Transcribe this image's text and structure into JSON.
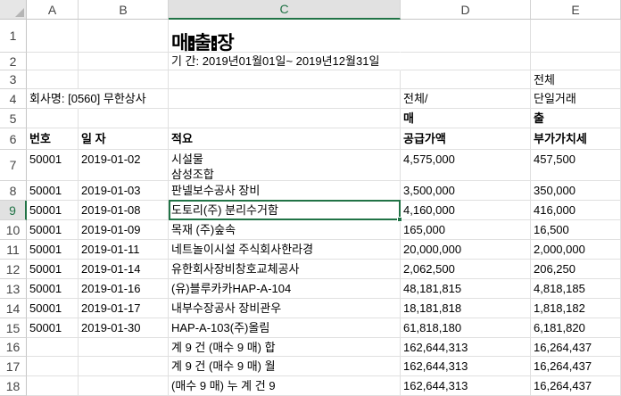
{
  "columns": [
    "A",
    "B",
    "C",
    "D",
    "E"
  ],
  "active_column": "C",
  "rows": [
    "1",
    "2",
    "3",
    "4",
    "5",
    "6",
    "7",
    "8",
    "9",
    "10",
    "11",
    "12",
    "13",
    "14",
    "15",
    "16",
    "17",
    "18"
  ],
  "active_row": "9",
  "title_parts": [
    "매",
    "출",
    "장"
  ],
  "period": "기 간: 2019년01월01일~ 2019년12월31일",
  "row3_e": "전체",
  "company": "회사명: [0560] 무한상사",
  "row4_d": "전체/",
  "row4_e": "단일거래",
  "row5_d": "매",
  "row5_e": "출",
  "headers": {
    "no": "번호",
    "date": "일 자",
    "summary": "적요",
    "supply": "공급가액",
    "vat": "부가가치세"
  },
  "data_rows": [
    {
      "no": "50001",
      "date": "2019-01-02",
      "summary": "시설물",
      "summary2": "삼성조합",
      "supply": "4,575,000",
      "vat": "457,500"
    },
    {
      "no": "50001",
      "date": "2019-01-03",
      "summary": "판넬보수공사 장비",
      "supply": "3,500,000",
      "vat": "350,000"
    },
    {
      "no": "50001",
      "date": "2019-01-08",
      "summary": "도토리(주) 분리수거함",
      "supply": "4,160,000",
      "vat": "416,000"
    },
    {
      "no": "50001",
      "date": "2019-01-09",
      "summary": "목재 (주)숲속",
      "supply": "165,000",
      "vat": "16,500"
    },
    {
      "no": "50001",
      "date": "2019-01-11",
      "summary": "네트놀이시설 주식회사한라경",
      "supply": "20,000,000",
      "vat": "2,000,000"
    },
    {
      "no": "50001",
      "date": "2019-01-14",
      "summary": "유한회사장비창호교체공사",
      "supply": "2,062,500",
      "vat": "206,250"
    },
    {
      "no": "50001",
      "date": "2019-01-16",
      "summary": "(유)블루카카HAP-A-104",
      "supply": "48,181,815",
      "vat": "4,818,185"
    },
    {
      "no": "50001",
      "date": "2019-01-17",
      "summary": "내부수장공사 장비관우",
      "supply": "18,181,818",
      "vat": "1,818,182"
    },
    {
      "no": "50001",
      "date": "2019-01-30",
      "summary": "HAP-A-103(주)올림",
      "supply": "61,818,180",
      "vat": "6,181,820"
    }
  ],
  "totals": [
    {
      "summary": "계 9 건 (매수 9 매) 합",
      "supply": "162,644,313",
      "vat": "16,264,437"
    },
    {
      "summary": "계 9 건 (매수 9 매) 월",
      "supply": "162,644,313",
      "vat": "16,264,437"
    },
    {
      "summary": "(매수 9 매) 누 계 건 9",
      "supply": "162,644,313",
      "vat": "16,264,437"
    }
  ]
}
